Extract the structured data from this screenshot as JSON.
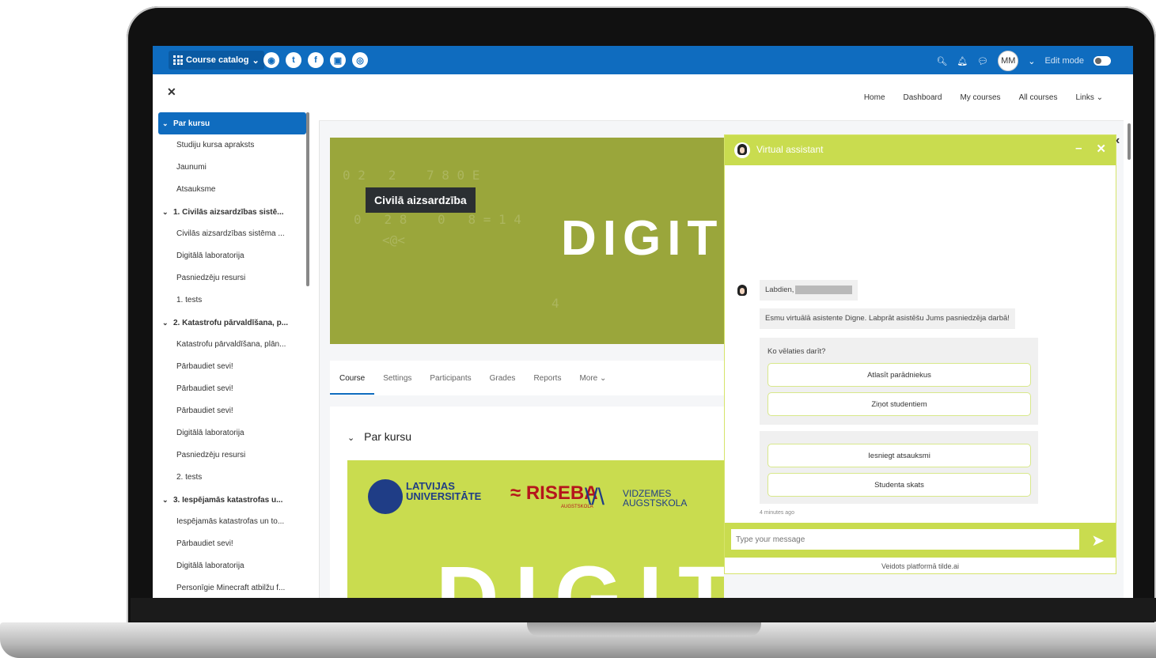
{
  "topbar": {
    "catalog_label": "Course catalog",
    "social_icons": [
      "globe-icon",
      "twitter-icon",
      "facebook-icon",
      "youtube-icon",
      "instagram-icon"
    ],
    "avatar_initials": "MM",
    "edit_mode_label": "Edit mode",
    "accent": "#0f6cbf"
  },
  "drawer": {
    "items": [
      {
        "label": "Par kursu",
        "type": "section",
        "active": true
      },
      {
        "label": "Studiju kursa apraksts",
        "type": "item"
      },
      {
        "label": "Jaunumi",
        "type": "item"
      },
      {
        "label": "Atsauksme",
        "type": "item"
      },
      {
        "label": "1. Civilās aizsardzības sistē...",
        "type": "section"
      },
      {
        "label": "Civilās aizsardzības sistēma ...",
        "type": "item"
      },
      {
        "label": "Digitālā laboratorija",
        "type": "item"
      },
      {
        "label": "Pasniedzēju resursi",
        "type": "item"
      },
      {
        "label": "1. tests",
        "type": "item"
      },
      {
        "label": "2. Katastrofu pārvaldīšana, p...",
        "type": "section"
      },
      {
        "label": "Katastrofu pārvaldīšana, plān...",
        "type": "item"
      },
      {
        "label": "Pārbaudiet sevi!",
        "type": "item"
      },
      {
        "label": "Pārbaudiet sevi!",
        "type": "item"
      },
      {
        "label": "Pārbaudiet sevi!",
        "type": "item"
      },
      {
        "label": "Digitālā laboratorija",
        "type": "item"
      },
      {
        "label": "Pasniedzēju resursi",
        "type": "item"
      },
      {
        "label": "2. tests",
        "type": "item"
      },
      {
        "label": "3. Iespējamās katastrofas u...",
        "type": "section"
      },
      {
        "label": "Iespējamās katastrofas un to...",
        "type": "item"
      },
      {
        "label": "Pārbaudiet sevi!",
        "type": "item"
      },
      {
        "label": "Digitālā laboratorija",
        "type": "item"
      },
      {
        "label": "Personīgie Minecraft atbilžu f...",
        "type": "item"
      }
    ]
  },
  "mainnav": {
    "links": [
      "Home",
      "Dashboard",
      "My courses",
      "All courses",
      "Links"
    ]
  },
  "course": {
    "title": "Civilā aizsardzība",
    "banner_logo_text": "DIGIT",
    "tabs": [
      "Course",
      "Settings",
      "Participants",
      "Grades",
      "Reports",
      "More"
    ],
    "section_title": "Par kursu",
    "partners": {
      "lu_line1": "LATVIJAS",
      "lu_line2": "UNIVERSITĀTE",
      "riseba": "RISEBA",
      "riseba_sub": "AUGSTSKOLA",
      "vidzemes_line1": "VIDZEMES",
      "vidzemes_line2": "AUGSTSKOLA",
      "big_text": "DIGITEA"
    },
    "banner_color": "#9aa63b",
    "partner_bg": "#c9dc4f"
  },
  "assistant": {
    "title": "Virtual assistant",
    "greeting": "Labdien,",
    "intro": "Esmu virtuālā asistente Digne. Labprāt asistēšu Jums pasniedzēja darbā!",
    "prompt": "Ko vēlaties darīt?",
    "options_group1": [
      "Atlasīt parādniekus",
      "Ziņot studentiem"
    ],
    "options_group2": [
      "Iesniegt atsauksmi",
      "Studenta skats"
    ],
    "timestamp": "4 minutes ago",
    "input_placeholder": "Type your message",
    "footer": "Veidots platformā tilde.ai",
    "accent": "#c9dc4f"
  }
}
